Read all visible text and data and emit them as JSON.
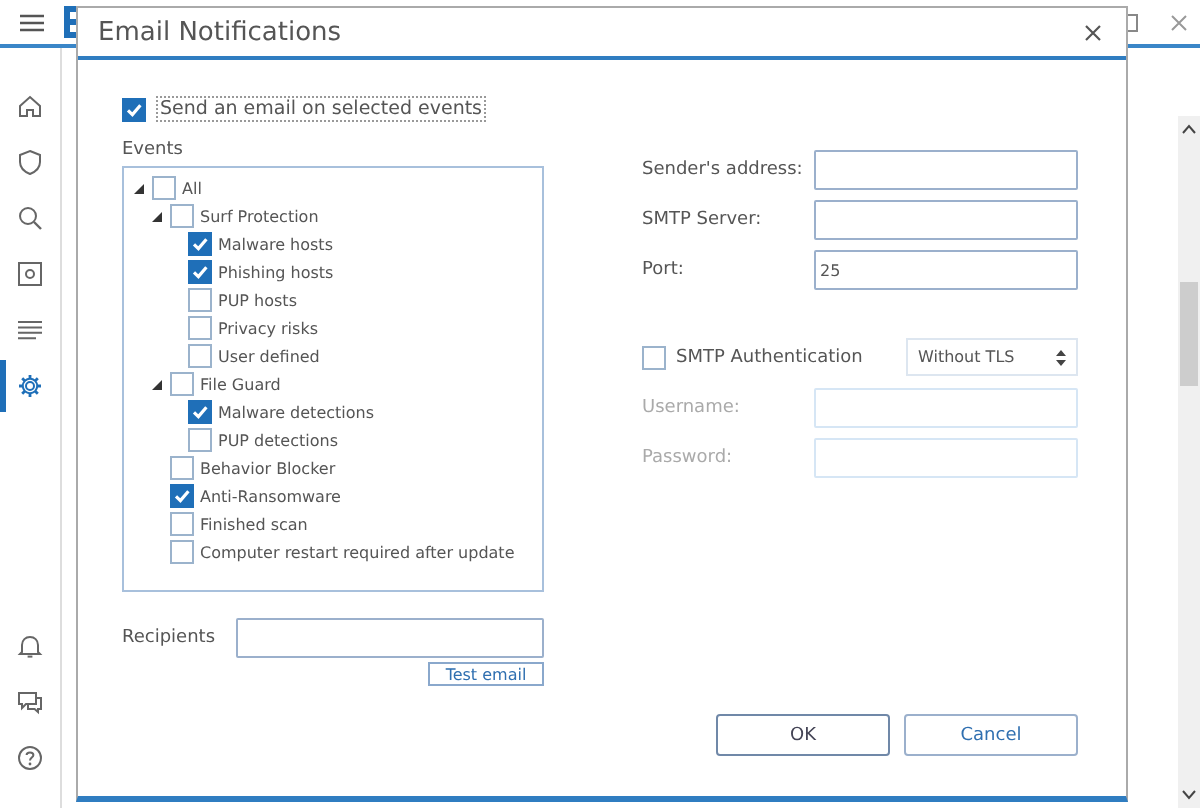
{
  "app": {
    "nav": [
      {
        "selected": false
      },
      {
        "selected": false
      },
      {
        "selected": false
      },
      {
        "selected": false
      },
      {
        "selected": false
      },
      {
        "selected": true
      }
    ]
  },
  "dialog": {
    "title": "Email Notifications",
    "send": {
      "label": "Send an email on selected events",
      "checked": true
    },
    "events_label": "Events",
    "events": [
      {
        "label": "All",
        "checked": false,
        "expanded": true,
        "children": [
          {
            "label": "Surf Protection",
            "checked": false,
            "expanded": true,
            "children": [
              {
                "label": "Malware hosts",
                "checked": true
              },
              {
                "label": "Phishing hosts",
                "checked": true
              },
              {
                "label": "PUP hosts",
                "checked": false
              },
              {
                "label": "Privacy risks",
                "checked": false
              },
              {
                "label": "User defined",
                "checked": false
              }
            ]
          },
          {
            "label": "File Guard",
            "checked": false,
            "expanded": true,
            "children": [
              {
                "label": "Malware detections",
                "checked": true
              },
              {
                "label": "PUP detections",
                "checked": false
              }
            ]
          },
          {
            "label": "Behavior Blocker",
            "checked": false
          },
          {
            "label": "Anti-Ransomware",
            "checked": true
          },
          {
            "label": "Finished scan",
            "checked": false
          },
          {
            "label": "Computer restart required after update",
            "checked": false
          }
        ]
      }
    ],
    "recipients": {
      "label": "Recipients"
    },
    "test_button": "Test email",
    "server_fields": [
      {
        "label": "Sender's address:",
        "disabled": false
      },
      {
        "label": "SMTP Server:",
        "disabled": false
      },
      {
        "label": "Port:",
        "value": "25",
        "disabled": false
      }
    ],
    "auth": {
      "label": "SMTP Authentication",
      "checked": false,
      "encryption": "Without TLS"
    },
    "auth_fields": [
      {
        "label": "Username:",
        "disabled": true
      },
      {
        "label": "Password:",
        "disabled": true
      }
    ],
    "buttons": [
      "OK",
      "Cancel"
    ]
  }
}
